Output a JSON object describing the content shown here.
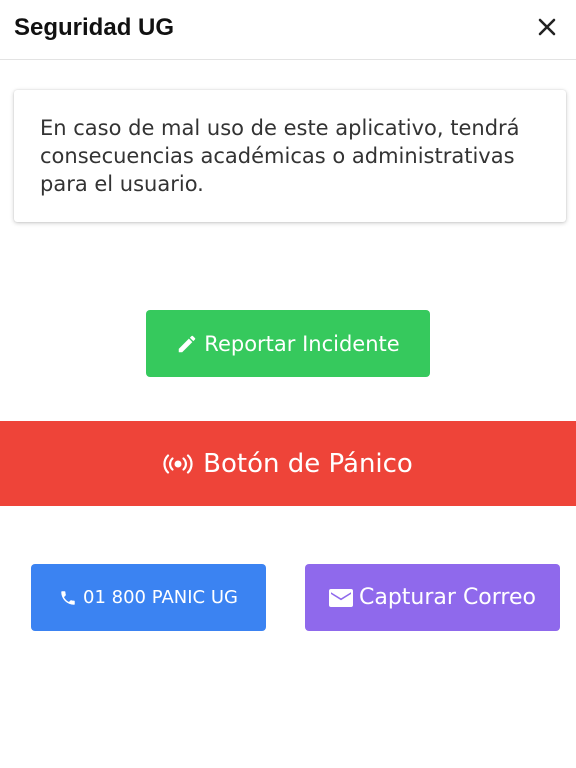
{
  "header": {
    "title": "Seguridad UG",
    "close_icon": "close-icon"
  },
  "notice": {
    "text": "En caso de mal uso de este aplicativo, tendrá consecuencias académicas o administrativas para el usuario."
  },
  "actions": {
    "report_label": "Reportar Incidente",
    "report_icon": "pencil-icon",
    "report_color": "#36c95d",
    "panic_label": "Botón de Pánico",
    "panic_icon": "broadcast-icon",
    "panic_color": "#ee4439",
    "phone_label": "01 800 PANIC UG",
    "phone_icon": "phone-icon",
    "phone_color": "#3b83f2",
    "mail_label": "Capturar Correo",
    "mail_icon": "envelope-icon",
    "mail_color": "#8f69ec"
  }
}
